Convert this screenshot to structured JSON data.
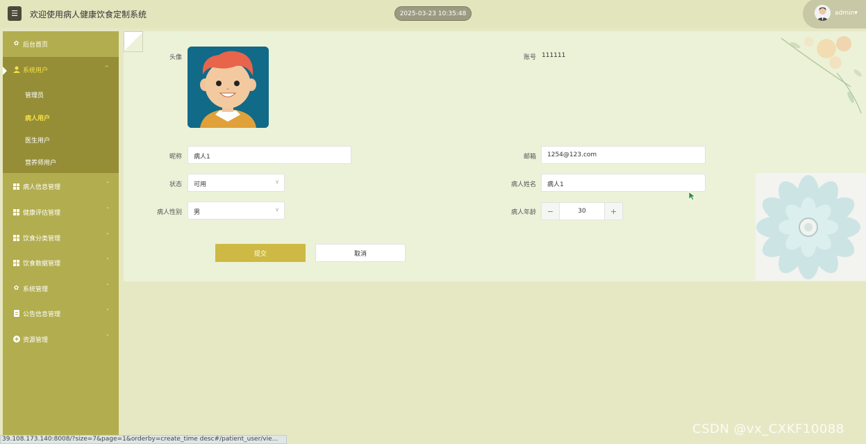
{
  "header": {
    "menu_icon": "hamburger-icon",
    "title": "欢迎使用病人健康饮食定制系统",
    "datetime": "2025-03-23 10:35:48",
    "user": "admin",
    "user_chevron": "▾"
  },
  "sidebar": {
    "home": {
      "icon": "home-icon",
      "label": "后台首页"
    },
    "open_group": {
      "icon": "user-icon",
      "label": "系统用户",
      "chevron": "^"
    },
    "sub_items": [
      {
        "label": "管理员",
        "active": false
      },
      {
        "label": "病人用户",
        "active": true
      },
      {
        "label": "医生用户",
        "active": false
      },
      {
        "label": "营养师用户",
        "active": false
      }
    ],
    "groups": [
      {
        "icon": "grid-icon",
        "label": "病人信息管理",
        "chevron": "ˇ"
      },
      {
        "icon": "grid-icon",
        "label": "健康评估管理",
        "chevron": "ˇ"
      },
      {
        "icon": "grid-icon",
        "label": "饮食分类管理",
        "chevron": "ˇ"
      },
      {
        "icon": "grid-icon",
        "label": "饮食数据管理",
        "chevron": "ˇ"
      },
      {
        "icon": "gear-icon",
        "label": "系统管理",
        "chevron": "ˇ"
      },
      {
        "icon": "document-icon",
        "label": "公告信息管理",
        "chevron": "ˇ"
      },
      {
        "icon": "plus-circle-icon",
        "label": "资源管理",
        "chevron": "ˇ"
      }
    ]
  },
  "form": {
    "avatar_label": "头像",
    "account_label": "账号",
    "account_value": "111111",
    "nickname_label": "昵称",
    "nickname_value": "病人1",
    "email_label": "邮箱",
    "email_value": "1254@123.com",
    "status_label": "状态",
    "status_value": "可用",
    "name_label": "病人姓名",
    "name_value": "病人1",
    "gender_label": "病人性别",
    "gender_value": "男",
    "age_label": "病人年龄",
    "age_value": "30",
    "minus": "−",
    "plus": "+",
    "select_chevron": "∨",
    "submit_label": "提交",
    "cancel_label": "取消"
  },
  "statusbar": {
    "url": "39.108.173.140:8008/?size=7&page=1&orderby=create_time desc#/patient_user/vie..."
  },
  "watermark": "CSDN @vx_CXKF10088",
  "colors": {
    "sidebar": "#b2ad4f",
    "sidebar_active": "#958e36",
    "highlight_text": "#f6e14a",
    "submit": "#cdb943"
  }
}
